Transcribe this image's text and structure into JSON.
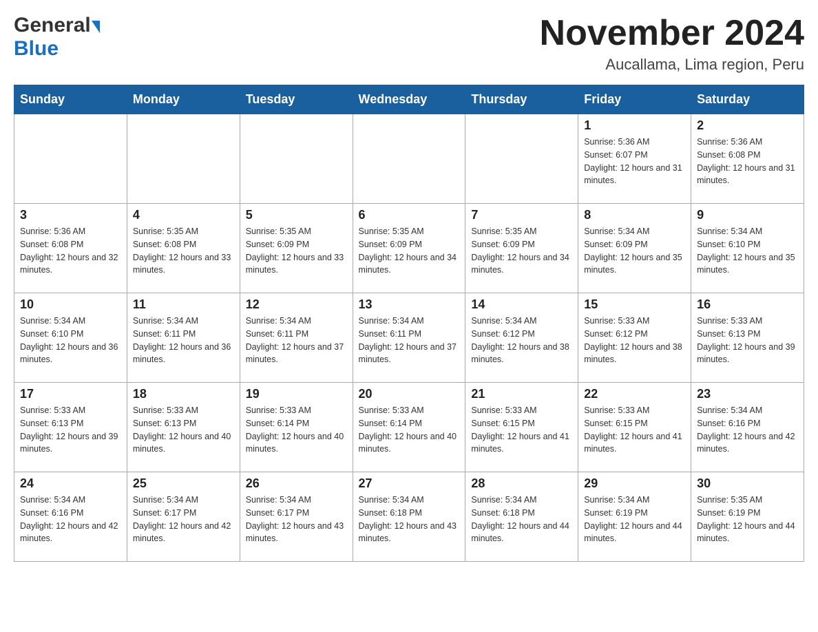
{
  "header": {
    "logo_general": "General",
    "logo_blue": "Blue",
    "month_title": "November 2024",
    "location": "Aucallama, Lima region, Peru"
  },
  "days_of_week": [
    "Sunday",
    "Monday",
    "Tuesday",
    "Wednesday",
    "Thursday",
    "Friday",
    "Saturday"
  ],
  "weeks": [
    {
      "days": [
        {
          "number": "",
          "sunrise": "",
          "sunset": "",
          "daylight": ""
        },
        {
          "number": "",
          "sunrise": "",
          "sunset": "",
          "daylight": ""
        },
        {
          "number": "",
          "sunrise": "",
          "sunset": "",
          "daylight": ""
        },
        {
          "number": "",
          "sunrise": "",
          "sunset": "",
          "daylight": ""
        },
        {
          "number": "",
          "sunrise": "",
          "sunset": "",
          "daylight": ""
        },
        {
          "number": "1",
          "sunrise": "Sunrise: 5:36 AM",
          "sunset": "Sunset: 6:07 PM",
          "daylight": "Daylight: 12 hours and 31 minutes."
        },
        {
          "number": "2",
          "sunrise": "Sunrise: 5:36 AM",
          "sunset": "Sunset: 6:08 PM",
          "daylight": "Daylight: 12 hours and 31 minutes."
        }
      ]
    },
    {
      "days": [
        {
          "number": "3",
          "sunrise": "Sunrise: 5:36 AM",
          "sunset": "Sunset: 6:08 PM",
          "daylight": "Daylight: 12 hours and 32 minutes."
        },
        {
          "number": "4",
          "sunrise": "Sunrise: 5:35 AM",
          "sunset": "Sunset: 6:08 PM",
          "daylight": "Daylight: 12 hours and 33 minutes."
        },
        {
          "number": "5",
          "sunrise": "Sunrise: 5:35 AM",
          "sunset": "Sunset: 6:09 PM",
          "daylight": "Daylight: 12 hours and 33 minutes."
        },
        {
          "number": "6",
          "sunrise": "Sunrise: 5:35 AM",
          "sunset": "Sunset: 6:09 PM",
          "daylight": "Daylight: 12 hours and 34 minutes."
        },
        {
          "number": "7",
          "sunrise": "Sunrise: 5:35 AM",
          "sunset": "Sunset: 6:09 PM",
          "daylight": "Daylight: 12 hours and 34 minutes."
        },
        {
          "number": "8",
          "sunrise": "Sunrise: 5:34 AM",
          "sunset": "Sunset: 6:09 PM",
          "daylight": "Daylight: 12 hours and 35 minutes."
        },
        {
          "number": "9",
          "sunrise": "Sunrise: 5:34 AM",
          "sunset": "Sunset: 6:10 PM",
          "daylight": "Daylight: 12 hours and 35 minutes."
        }
      ]
    },
    {
      "days": [
        {
          "number": "10",
          "sunrise": "Sunrise: 5:34 AM",
          "sunset": "Sunset: 6:10 PM",
          "daylight": "Daylight: 12 hours and 36 minutes."
        },
        {
          "number": "11",
          "sunrise": "Sunrise: 5:34 AM",
          "sunset": "Sunset: 6:11 PM",
          "daylight": "Daylight: 12 hours and 36 minutes."
        },
        {
          "number": "12",
          "sunrise": "Sunrise: 5:34 AM",
          "sunset": "Sunset: 6:11 PM",
          "daylight": "Daylight: 12 hours and 37 minutes."
        },
        {
          "number": "13",
          "sunrise": "Sunrise: 5:34 AM",
          "sunset": "Sunset: 6:11 PM",
          "daylight": "Daylight: 12 hours and 37 minutes."
        },
        {
          "number": "14",
          "sunrise": "Sunrise: 5:34 AM",
          "sunset": "Sunset: 6:12 PM",
          "daylight": "Daylight: 12 hours and 38 minutes."
        },
        {
          "number": "15",
          "sunrise": "Sunrise: 5:33 AM",
          "sunset": "Sunset: 6:12 PM",
          "daylight": "Daylight: 12 hours and 38 minutes."
        },
        {
          "number": "16",
          "sunrise": "Sunrise: 5:33 AM",
          "sunset": "Sunset: 6:13 PM",
          "daylight": "Daylight: 12 hours and 39 minutes."
        }
      ]
    },
    {
      "days": [
        {
          "number": "17",
          "sunrise": "Sunrise: 5:33 AM",
          "sunset": "Sunset: 6:13 PM",
          "daylight": "Daylight: 12 hours and 39 minutes."
        },
        {
          "number": "18",
          "sunrise": "Sunrise: 5:33 AM",
          "sunset": "Sunset: 6:13 PM",
          "daylight": "Daylight: 12 hours and 40 minutes."
        },
        {
          "number": "19",
          "sunrise": "Sunrise: 5:33 AM",
          "sunset": "Sunset: 6:14 PM",
          "daylight": "Daylight: 12 hours and 40 minutes."
        },
        {
          "number": "20",
          "sunrise": "Sunrise: 5:33 AM",
          "sunset": "Sunset: 6:14 PM",
          "daylight": "Daylight: 12 hours and 40 minutes."
        },
        {
          "number": "21",
          "sunrise": "Sunrise: 5:33 AM",
          "sunset": "Sunset: 6:15 PM",
          "daylight": "Daylight: 12 hours and 41 minutes."
        },
        {
          "number": "22",
          "sunrise": "Sunrise: 5:33 AM",
          "sunset": "Sunset: 6:15 PM",
          "daylight": "Daylight: 12 hours and 41 minutes."
        },
        {
          "number": "23",
          "sunrise": "Sunrise: 5:34 AM",
          "sunset": "Sunset: 6:16 PM",
          "daylight": "Daylight: 12 hours and 42 minutes."
        }
      ]
    },
    {
      "days": [
        {
          "number": "24",
          "sunrise": "Sunrise: 5:34 AM",
          "sunset": "Sunset: 6:16 PM",
          "daylight": "Daylight: 12 hours and 42 minutes."
        },
        {
          "number": "25",
          "sunrise": "Sunrise: 5:34 AM",
          "sunset": "Sunset: 6:17 PM",
          "daylight": "Daylight: 12 hours and 42 minutes."
        },
        {
          "number": "26",
          "sunrise": "Sunrise: 5:34 AM",
          "sunset": "Sunset: 6:17 PM",
          "daylight": "Daylight: 12 hours and 43 minutes."
        },
        {
          "number": "27",
          "sunrise": "Sunrise: 5:34 AM",
          "sunset": "Sunset: 6:18 PM",
          "daylight": "Daylight: 12 hours and 43 minutes."
        },
        {
          "number": "28",
          "sunrise": "Sunrise: 5:34 AM",
          "sunset": "Sunset: 6:18 PM",
          "daylight": "Daylight: 12 hours and 44 minutes."
        },
        {
          "number": "29",
          "sunrise": "Sunrise: 5:34 AM",
          "sunset": "Sunset: 6:19 PM",
          "daylight": "Daylight: 12 hours and 44 minutes."
        },
        {
          "number": "30",
          "sunrise": "Sunrise: 5:35 AM",
          "sunset": "Sunset: 6:19 PM",
          "daylight": "Daylight: 12 hours and 44 minutes."
        }
      ]
    }
  ]
}
